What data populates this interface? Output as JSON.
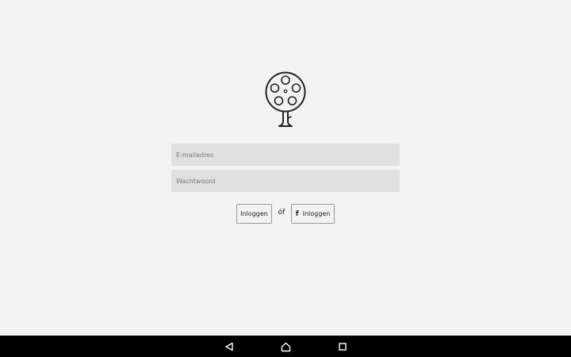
{
  "login": {
    "email_placeholder": "E-mailadres",
    "password_placeholder": "Wachtwoord",
    "email_value": "",
    "password_value": "",
    "login_button_label": "Inloggen",
    "or_text": "óf",
    "facebook_icon_glyph": "f",
    "facebook_button_label": "Inloggen"
  },
  "logo": {
    "icon": "film-reel-tree-icon"
  },
  "navbar": {
    "back_icon": "back-triangle-icon",
    "home_icon": "home-icon",
    "recent_icon": "recent-apps-icon"
  },
  "colors": {
    "background": "#f2f2f2",
    "input_background": "#e0e0e0",
    "button_border": "#9a9a9a",
    "navbar": "#000000"
  }
}
